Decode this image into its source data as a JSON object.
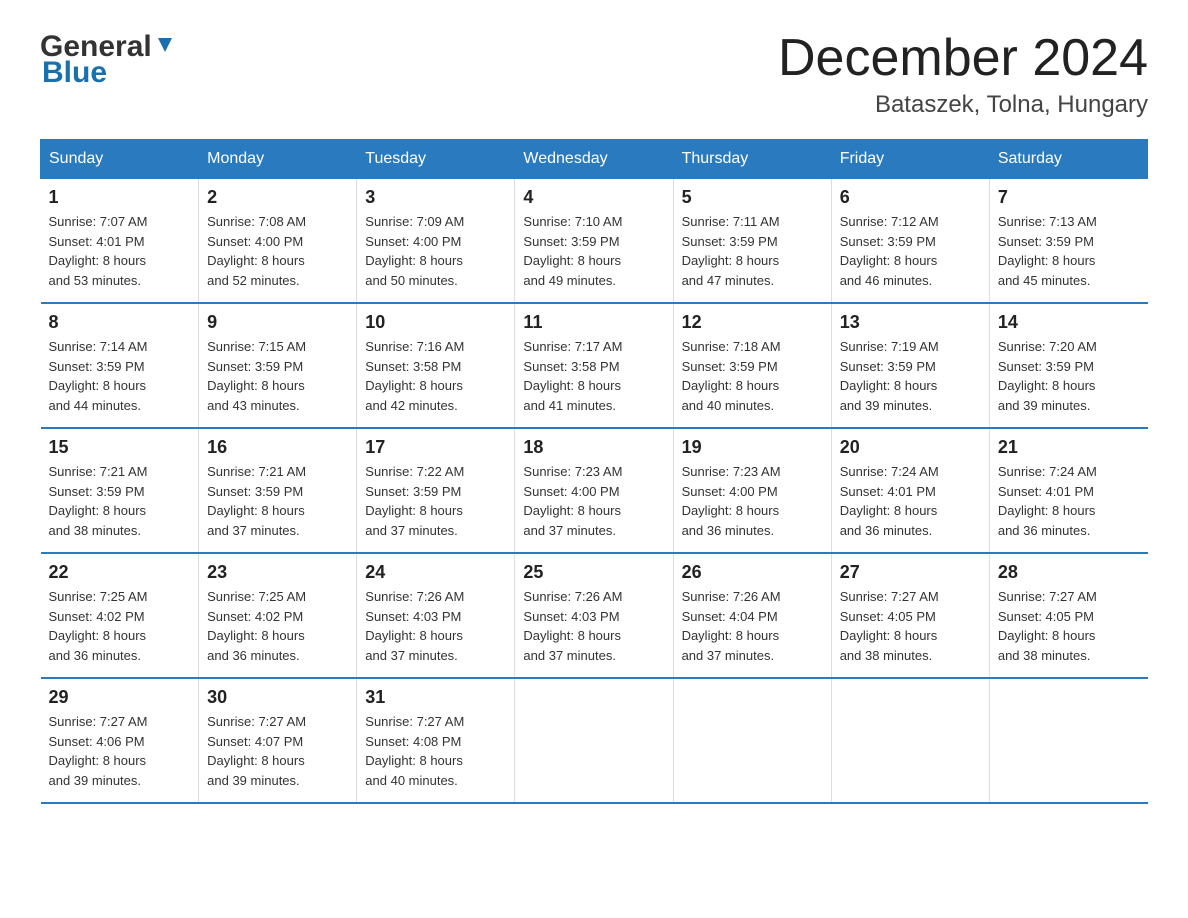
{
  "logo": {
    "text_general": "General",
    "text_blue": "Blue",
    "arrow": "▲"
  },
  "header": {
    "month_year": "December 2024",
    "location": "Bataszek, Tolna, Hungary"
  },
  "days_of_week": [
    "Sunday",
    "Monday",
    "Tuesday",
    "Wednesday",
    "Thursday",
    "Friday",
    "Saturday"
  ],
  "weeks": [
    [
      {
        "day": "1",
        "sunrise": "7:07 AM",
        "sunset": "4:01 PM",
        "daylight": "8 hours and 53 minutes."
      },
      {
        "day": "2",
        "sunrise": "7:08 AM",
        "sunset": "4:00 PM",
        "daylight": "8 hours and 52 minutes."
      },
      {
        "day": "3",
        "sunrise": "7:09 AM",
        "sunset": "4:00 PM",
        "daylight": "8 hours and 50 minutes."
      },
      {
        "day": "4",
        "sunrise": "7:10 AM",
        "sunset": "3:59 PM",
        "daylight": "8 hours and 49 minutes."
      },
      {
        "day": "5",
        "sunrise": "7:11 AM",
        "sunset": "3:59 PM",
        "daylight": "8 hours and 47 minutes."
      },
      {
        "day": "6",
        "sunrise": "7:12 AM",
        "sunset": "3:59 PM",
        "daylight": "8 hours and 46 minutes."
      },
      {
        "day": "7",
        "sunrise": "7:13 AM",
        "sunset": "3:59 PM",
        "daylight": "8 hours and 45 minutes."
      }
    ],
    [
      {
        "day": "8",
        "sunrise": "7:14 AM",
        "sunset": "3:59 PM",
        "daylight": "8 hours and 44 minutes."
      },
      {
        "day": "9",
        "sunrise": "7:15 AM",
        "sunset": "3:59 PM",
        "daylight": "8 hours and 43 minutes."
      },
      {
        "day": "10",
        "sunrise": "7:16 AM",
        "sunset": "3:58 PM",
        "daylight": "8 hours and 42 minutes."
      },
      {
        "day": "11",
        "sunrise": "7:17 AM",
        "sunset": "3:58 PM",
        "daylight": "8 hours and 41 minutes."
      },
      {
        "day": "12",
        "sunrise": "7:18 AM",
        "sunset": "3:59 PM",
        "daylight": "8 hours and 40 minutes."
      },
      {
        "day": "13",
        "sunrise": "7:19 AM",
        "sunset": "3:59 PM",
        "daylight": "8 hours and 39 minutes."
      },
      {
        "day": "14",
        "sunrise": "7:20 AM",
        "sunset": "3:59 PM",
        "daylight": "8 hours and 39 minutes."
      }
    ],
    [
      {
        "day": "15",
        "sunrise": "7:21 AM",
        "sunset": "3:59 PM",
        "daylight": "8 hours and 38 minutes."
      },
      {
        "day": "16",
        "sunrise": "7:21 AM",
        "sunset": "3:59 PM",
        "daylight": "8 hours and 37 minutes."
      },
      {
        "day": "17",
        "sunrise": "7:22 AM",
        "sunset": "3:59 PM",
        "daylight": "8 hours and 37 minutes."
      },
      {
        "day": "18",
        "sunrise": "7:23 AM",
        "sunset": "4:00 PM",
        "daylight": "8 hours and 37 minutes."
      },
      {
        "day": "19",
        "sunrise": "7:23 AM",
        "sunset": "4:00 PM",
        "daylight": "8 hours and 36 minutes."
      },
      {
        "day": "20",
        "sunrise": "7:24 AM",
        "sunset": "4:01 PM",
        "daylight": "8 hours and 36 minutes."
      },
      {
        "day": "21",
        "sunrise": "7:24 AM",
        "sunset": "4:01 PM",
        "daylight": "8 hours and 36 minutes."
      }
    ],
    [
      {
        "day": "22",
        "sunrise": "7:25 AM",
        "sunset": "4:02 PM",
        "daylight": "8 hours and 36 minutes."
      },
      {
        "day": "23",
        "sunrise": "7:25 AM",
        "sunset": "4:02 PM",
        "daylight": "8 hours and 36 minutes."
      },
      {
        "day": "24",
        "sunrise": "7:26 AM",
        "sunset": "4:03 PM",
        "daylight": "8 hours and 37 minutes."
      },
      {
        "day": "25",
        "sunrise": "7:26 AM",
        "sunset": "4:03 PM",
        "daylight": "8 hours and 37 minutes."
      },
      {
        "day": "26",
        "sunrise": "7:26 AM",
        "sunset": "4:04 PM",
        "daylight": "8 hours and 37 minutes."
      },
      {
        "day": "27",
        "sunrise": "7:27 AM",
        "sunset": "4:05 PM",
        "daylight": "8 hours and 38 minutes."
      },
      {
        "day": "28",
        "sunrise": "7:27 AM",
        "sunset": "4:05 PM",
        "daylight": "8 hours and 38 minutes."
      }
    ],
    [
      {
        "day": "29",
        "sunrise": "7:27 AM",
        "sunset": "4:06 PM",
        "daylight": "8 hours and 39 minutes."
      },
      {
        "day": "30",
        "sunrise": "7:27 AM",
        "sunset": "4:07 PM",
        "daylight": "8 hours and 39 minutes."
      },
      {
        "day": "31",
        "sunrise": "7:27 AM",
        "sunset": "4:08 PM",
        "daylight": "8 hours and 40 minutes."
      },
      null,
      null,
      null,
      null
    ]
  ],
  "labels": {
    "sunrise": "Sunrise:",
    "sunset": "Sunset:",
    "daylight": "Daylight:"
  }
}
